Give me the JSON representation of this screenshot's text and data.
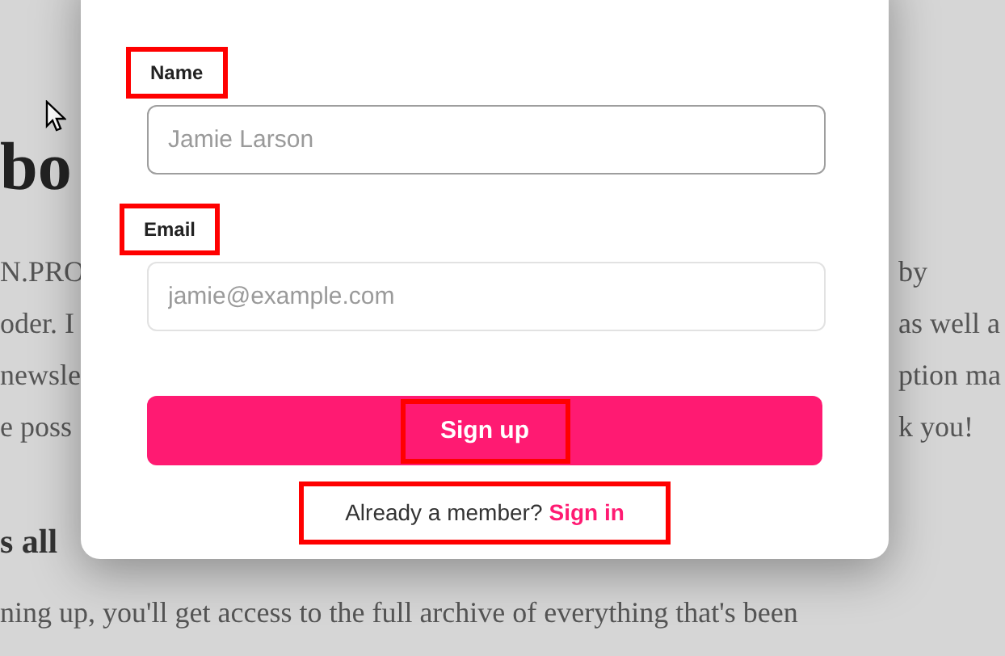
{
  "backdrop": {
    "heading": "bo",
    "lines": [
      {
        "left": "N.PRO",
        "right": "by"
      },
      {
        "left": "oder. I",
        "right": "as well a"
      },
      {
        "left": "newsle",
        "right": "ption ma"
      },
      {
        "left": "e poss",
        "right": "k you!"
      }
    ],
    "subheading": "s all",
    "paragraph": "ning up, you'll get access to the full archive of everything that's been"
  },
  "form": {
    "fields": [
      {
        "label": "Name",
        "placeholder": "Jamie Larson",
        "focused": true,
        "highlighted": true
      },
      {
        "label": "Email",
        "placeholder": "jamie@example.com",
        "focused": false,
        "highlighted": true
      }
    ],
    "submit": {
      "label": "Sign up",
      "highlighted": true
    },
    "footer": {
      "text": "Already a member?",
      "link": "Sign in",
      "highlighted": true
    }
  }
}
